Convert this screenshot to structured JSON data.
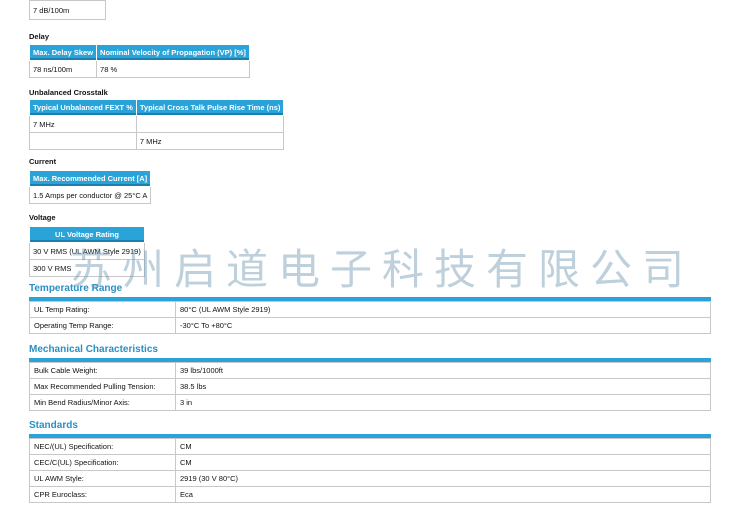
{
  "attenuation": {
    "value": "7 dB/100m"
  },
  "delay": {
    "title": "Delay",
    "headers": [
      "Max. Delay Skew",
      "Nominal Velocity of Propagation (VP) [%]"
    ],
    "row": [
      "78 ns/100m",
      "78 %"
    ]
  },
  "crosstalk": {
    "title": "Unbalanced Crosstalk",
    "headers": [
      "Typical Unbalanced FEXT %",
      "Typical Cross Talk Pulse Rise Time (ns)"
    ],
    "rows": [
      [
        "7 MHz",
        ""
      ],
      [
        "",
        "7 MHz"
      ]
    ]
  },
  "current": {
    "title": "Current",
    "header": "Max. Recommended Current [A]",
    "value": "1.5 Amps per conductor @ 25°C A"
  },
  "voltage": {
    "title": "Voltage",
    "header": "UL Voltage Rating",
    "rows": [
      "30 V RMS (UL AWM Style 2919)",
      "300 V RMS"
    ]
  },
  "temperature": {
    "title": "Temperature Range",
    "rows": [
      {
        "label": "UL Temp Rating:",
        "value": "80°C (UL AWM Style 2919)"
      },
      {
        "label": "Operating Temp Range:",
        "value": "-30°C To +80°C"
      }
    ]
  },
  "mechanical": {
    "title": "Mechanical Characteristics",
    "rows": [
      {
        "label": "Bulk Cable Weight:",
        "value": "39 lbs/1000ft"
      },
      {
        "label": "Max Recommended Pulling Tension:",
        "value": "38.5 lbs"
      },
      {
        "label": "Min Bend Radius/Minor Axis:",
        "value": "3 in"
      }
    ]
  },
  "standards": {
    "title": "Standards",
    "rows": [
      {
        "label": "NEC/(UL) Specification:",
        "value": "CM"
      },
      {
        "label": "CEC/C(UL) Specification:",
        "value": "CM"
      },
      {
        "label": "UL AWM Style:",
        "value": "2919 (30 V 80°C)"
      },
      {
        "label": "CPR Euroclass:",
        "value": "Eca"
      }
    ]
  },
  "watermark": "苏州启道电子科技有限公司"
}
